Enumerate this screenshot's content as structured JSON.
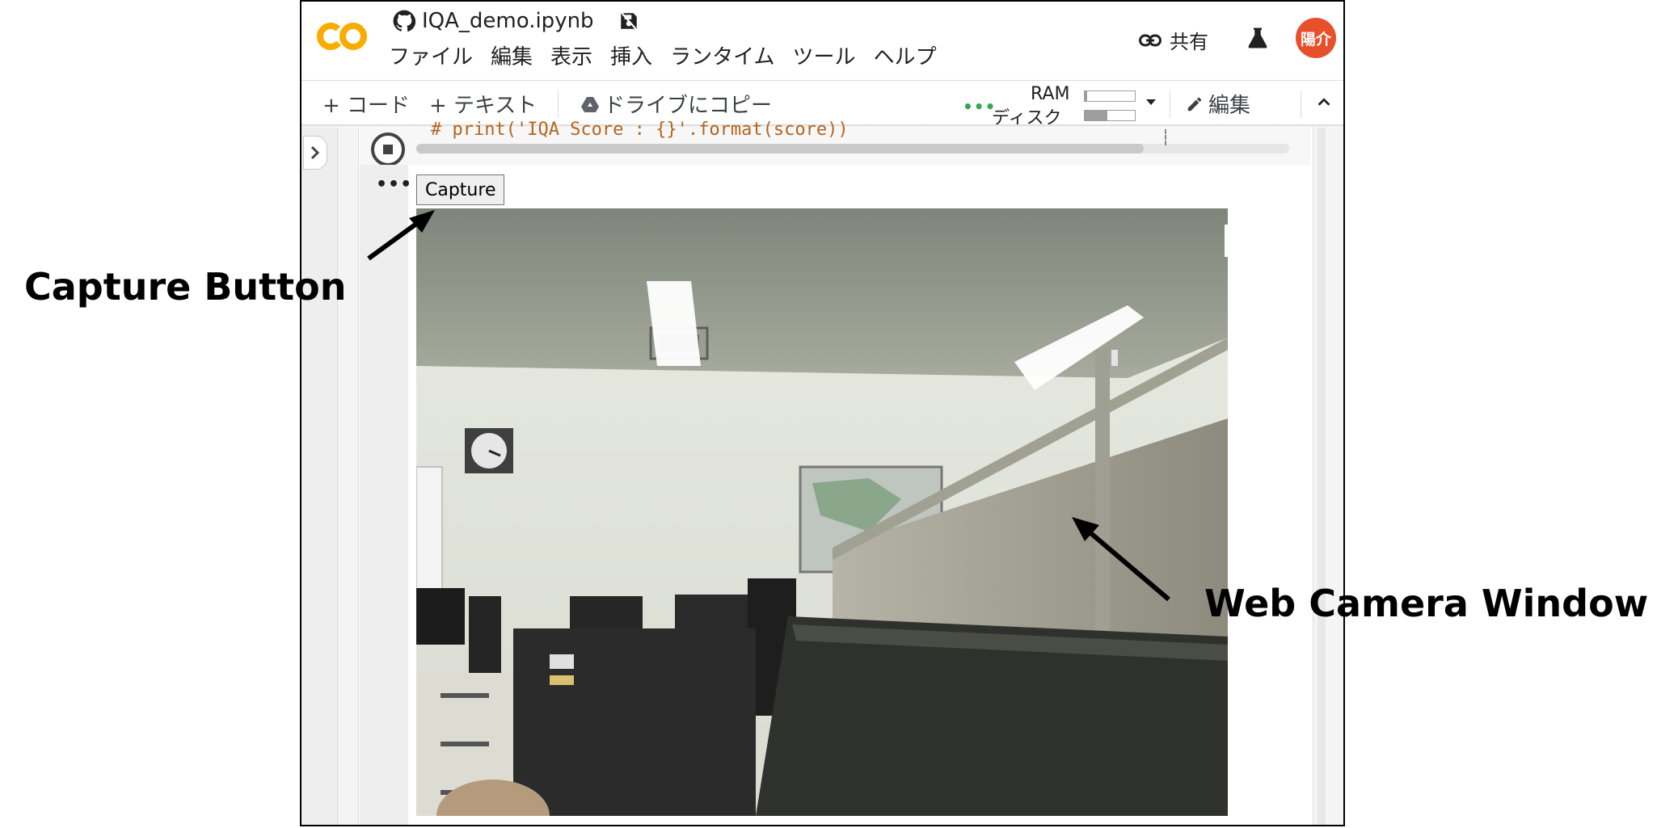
{
  "notebook": {
    "title": "IQA_demo.ipynb",
    "menu": [
      "ファイル",
      "編集",
      "表示",
      "挿入",
      "ランタイム",
      "ツール",
      "ヘルプ"
    ],
    "share_label": "共有",
    "avatar_text": "陽介"
  },
  "toolbar": {
    "add_code": "+ コード",
    "add_text": "+ テキスト",
    "copy_to_drive": "ドライブにコピー",
    "ram_label": "RAM",
    "disk_label": "ディスク",
    "ram_fraction": 0.05,
    "disk_fraction": 0.45,
    "edit_label": "編集"
  },
  "cell": {
    "code_line": "# print('IQA Score : {}'.format(score))",
    "capture_label": "Capture"
  },
  "annotations": {
    "capture_button": "Capture Button",
    "web_camera": "Web Camera Window"
  },
  "colors": {
    "colab_logo": "#f9ab00",
    "avatar": "#e8502b",
    "code_comment": "#b5651d",
    "status_green": "#34a853"
  }
}
